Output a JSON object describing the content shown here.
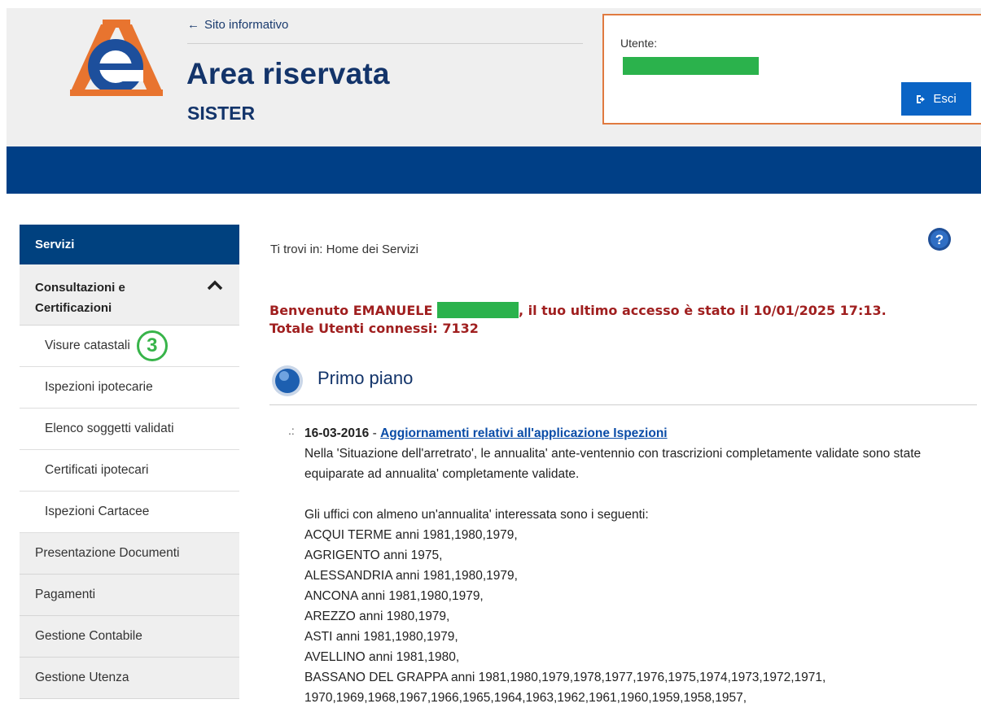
{
  "header": {
    "back_link": "Sito informativo",
    "title": "Area riservata",
    "subtitle": "SISTER",
    "user_label": "Utente:",
    "logout_label": "Esci"
  },
  "sidebar": {
    "head": "Servizi",
    "group": "Consultazioni e Certificazioni",
    "sub_items": [
      "Visure catastali",
      "Ispezioni ipotecarie",
      "Elenco soggetti validati",
      "Certificati ipotecari",
      "Ispezioni Cartacee"
    ],
    "step_number": "3",
    "main_items": [
      "Presentazione Documenti",
      "Pagamenti",
      "Gestione Contabile",
      "Gestione Utenza"
    ]
  },
  "content": {
    "breadcrumb": "Ti trovi in: Home dei Servizi",
    "welcome_prefix": "Benvenuto EMANUELE ",
    "welcome_suffix": ", il tuo ultimo accesso è stato il 10/01/2025 17:13.",
    "connected": "Totale Utenti connessi: 7132",
    "section_title": "Primo piano",
    "news": {
      "date": "16-03-2016",
      "separator": " - ",
      "link": "Aggiornamenti relativi all'applicazione Ispezioni",
      "paragraph": "Nella 'Situazione dell'arretrato', le annualita' ante-ventennio con trascrizioni completamente validate sono state equiparate ad annualita' completamente validate.",
      "intro": "Gli uffici con almeno un'annualita' interessata sono i seguenti:",
      "lines": [
        "ACQUI TERME anni 1981,1980,1979,",
        "AGRIGENTO anni 1975,",
        "ALESSANDRIA anni 1981,1980,1979,",
        "ANCONA anni 1981,1980,1979,",
        "AREZZO anni 1980,1979,",
        "ASTI anni 1981,1980,1979,",
        "AVELLINO anni 1981,1980,",
        "BASSANO DEL GRAPPA anni 1981,1980,1979,1978,1977,1976,1975,1974,1973,1972,1971,",
        "1970,1969,1968,1967,1966,1965,1964,1963,1962,1961,1960,1959,1958,1957,"
      ]
    }
  },
  "colors": {
    "navy": "#003f86",
    "title_blue": "#13346a",
    "welcome_red": "#a01f1f",
    "user_border": "#e07a40",
    "redaction_green": "#2bb24c",
    "button_blue": "#0a64c5"
  }
}
